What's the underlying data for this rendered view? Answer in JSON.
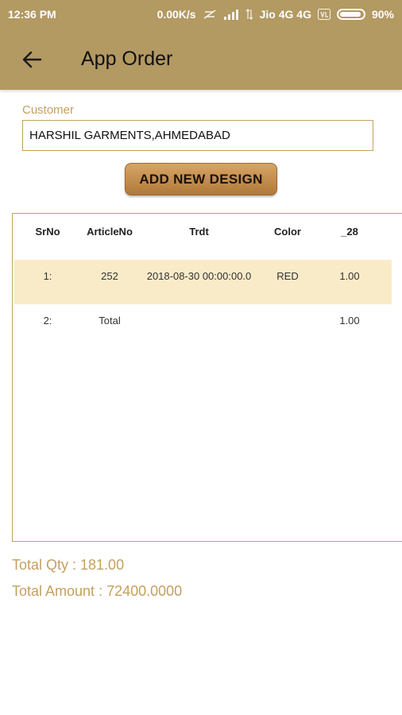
{
  "status_bar": {
    "time": "12:36 PM",
    "speed": "0.00K/s",
    "network": "Jio 4G 4G",
    "battery": "90%"
  },
  "app_bar": {
    "title": "App Order",
    "back_icon": "arrow-back-icon"
  },
  "customer": {
    "label": "Customer",
    "value": "HARSHIL GARMENTS,AHMEDABAD"
  },
  "add_button": {
    "label": "ADD NEW  DESIGN"
  },
  "table": {
    "headers": [
      "SrNo",
      "ArticleNo",
      "Trdt",
      "Color",
      "_28"
    ],
    "rows": [
      [
        "1:",
        "252",
        "2018-08-30 00:00:00.0",
        "RED",
        "1.00"
      ],
      [
        "2:",
        "Total",
        "",
        "",
        "1.00"
      ]
    ]
  },
  "totals": {
    "qty": "Total Qty : 181.00",
    "amount": "Total Amount : 72400.0000"
  },
  "colors": {
    "primary": "#b39962",
    "accent": "#c4a060",
    "row_highlight": "#faebc8"
  }
}
